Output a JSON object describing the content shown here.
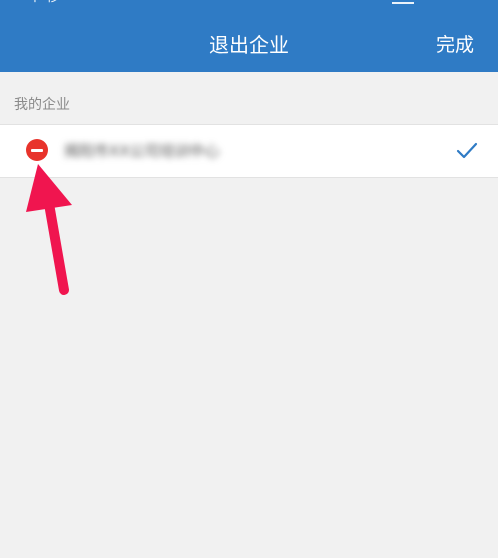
{
  "nav": {
    "title": "退出企业",
    "done_label": "完成",
    "status_left": "中移"
  },
  "section": {
    "header": "我的企业"
  },
  "company": {
    "name": "揭阳市XX公司培训中心",
    "selected": true
  },
  "colors": {
    "nav_bg": "#2f7bc5",
    "remove_red": "#e8332b",
    "check_blue": "#2f7bc5",
    "annotation_arrow": "#f0154f"
  },
  "icons": {
    "remove": "minus-circle-icon",
    "check": "checkmark-icon",
    "annotation": "arrow-up-icon"
  }
}
